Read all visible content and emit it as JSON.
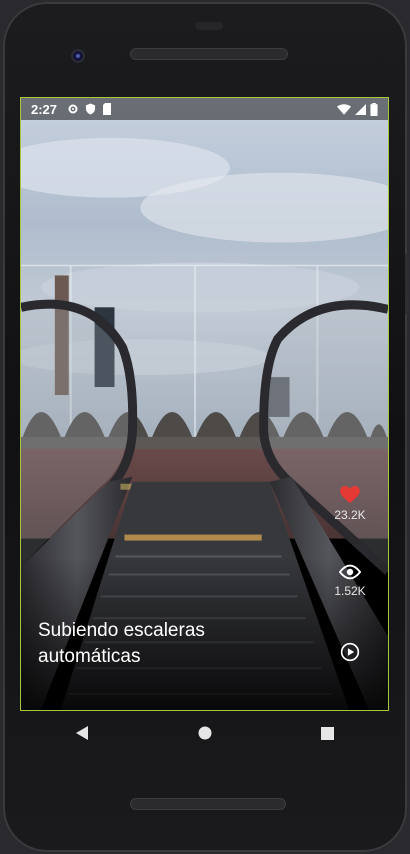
{
  "status_bar": {
    "time": "2:27",
    "icons": [
      "settings-icon",
      "shield-icon",
      "sd-card-icon"
    ],
    "right_icons": [
      "wifi-icon",
      "signal-icon",
      "battery-icon"
    ]
  },
  "post": {
    "title": "Subiendo escaleras automáticas",
    "likes": "23.2K",
    "views": "1.52K",
    "like_color": "#e53935"
  },
  "nav": {
    "buttons": [
      "back-icon",
      "home-icon",
      "recents-icon"
    ]
  }
}
